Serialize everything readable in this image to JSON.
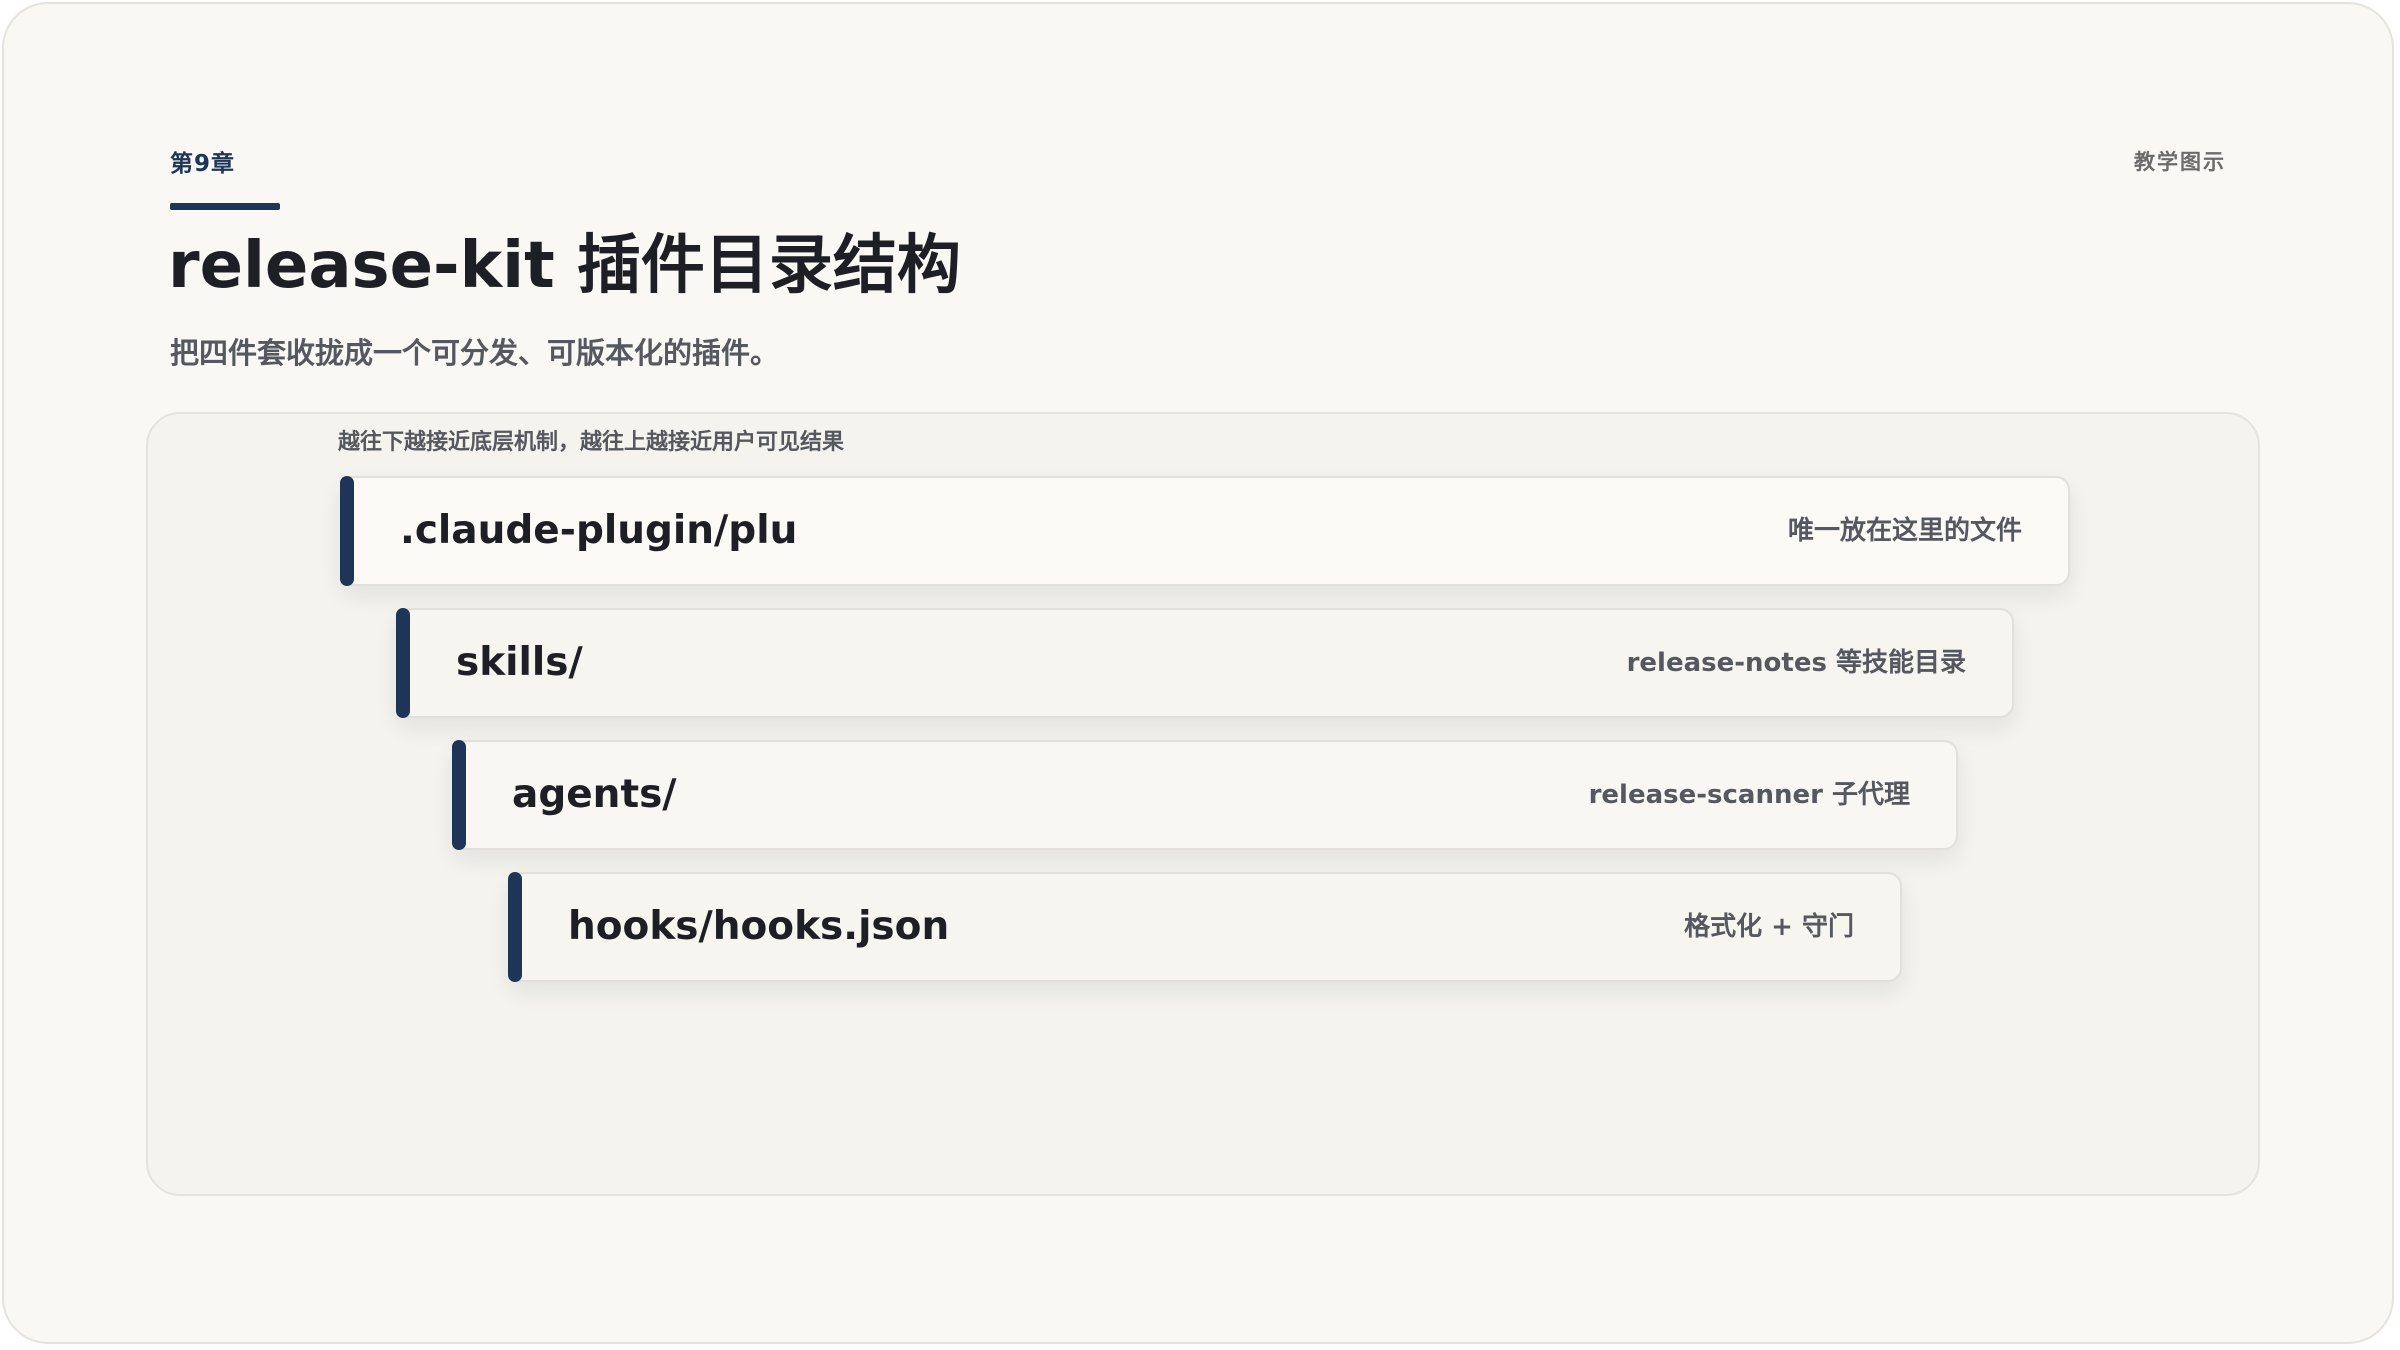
{
  "header": {
    "chapter": "第9章",
    "kind": "教学图示",
    "title": "release-kit 插件目录结构",
    "subtitle": "把四件套收拢成一个可分发、可版本化的插件。"
  },
  "diagram": {
    "note": "越往下越接近底层机制，越往上越接近用户可见结果",
    "layers": [
      {
        "name": ".claude-plugin/plu",
        "desc": "唯一放在这里的文件"
      },
      {
        "name": "skills/",
        "desc": "release-notes 等技能目录"
      },
      {
        "name": "agents/",
        "desc": "release-scanner 子代理"
      },
      {
        "name": "hooks/hooks.json",
        "desc": "格式化 + 守门"
      }
    ]
  },
  "colors": {
    "accent": "#1e3557",
    "background": "#f9f8f4",
    "panel": "#f4f3ed"
  }
}
